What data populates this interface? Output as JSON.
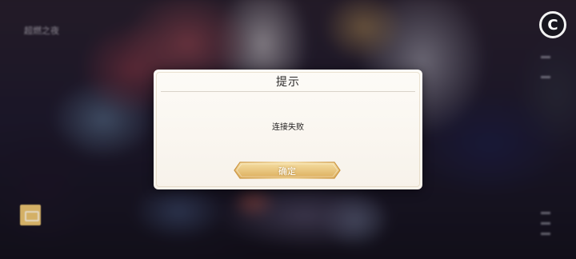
{
  "background": {
    "title_text": "超燃之夜"
  },
  "corner_button": {
    "icon": "circle-c-icon",
    "glyph": "C"
  },
  "dialog": {
    "title": "提示",
    "message": "连接失败",
    "confirm_label": "确定"
  },
  "colors": {
    "dialog_bg": "#fdfbf7",
    "button_gold_light": "#f6dfa4",
    "button_gold_dark": "#d9a954",
    "text_dark": "#2c2a2a"
  }
}
